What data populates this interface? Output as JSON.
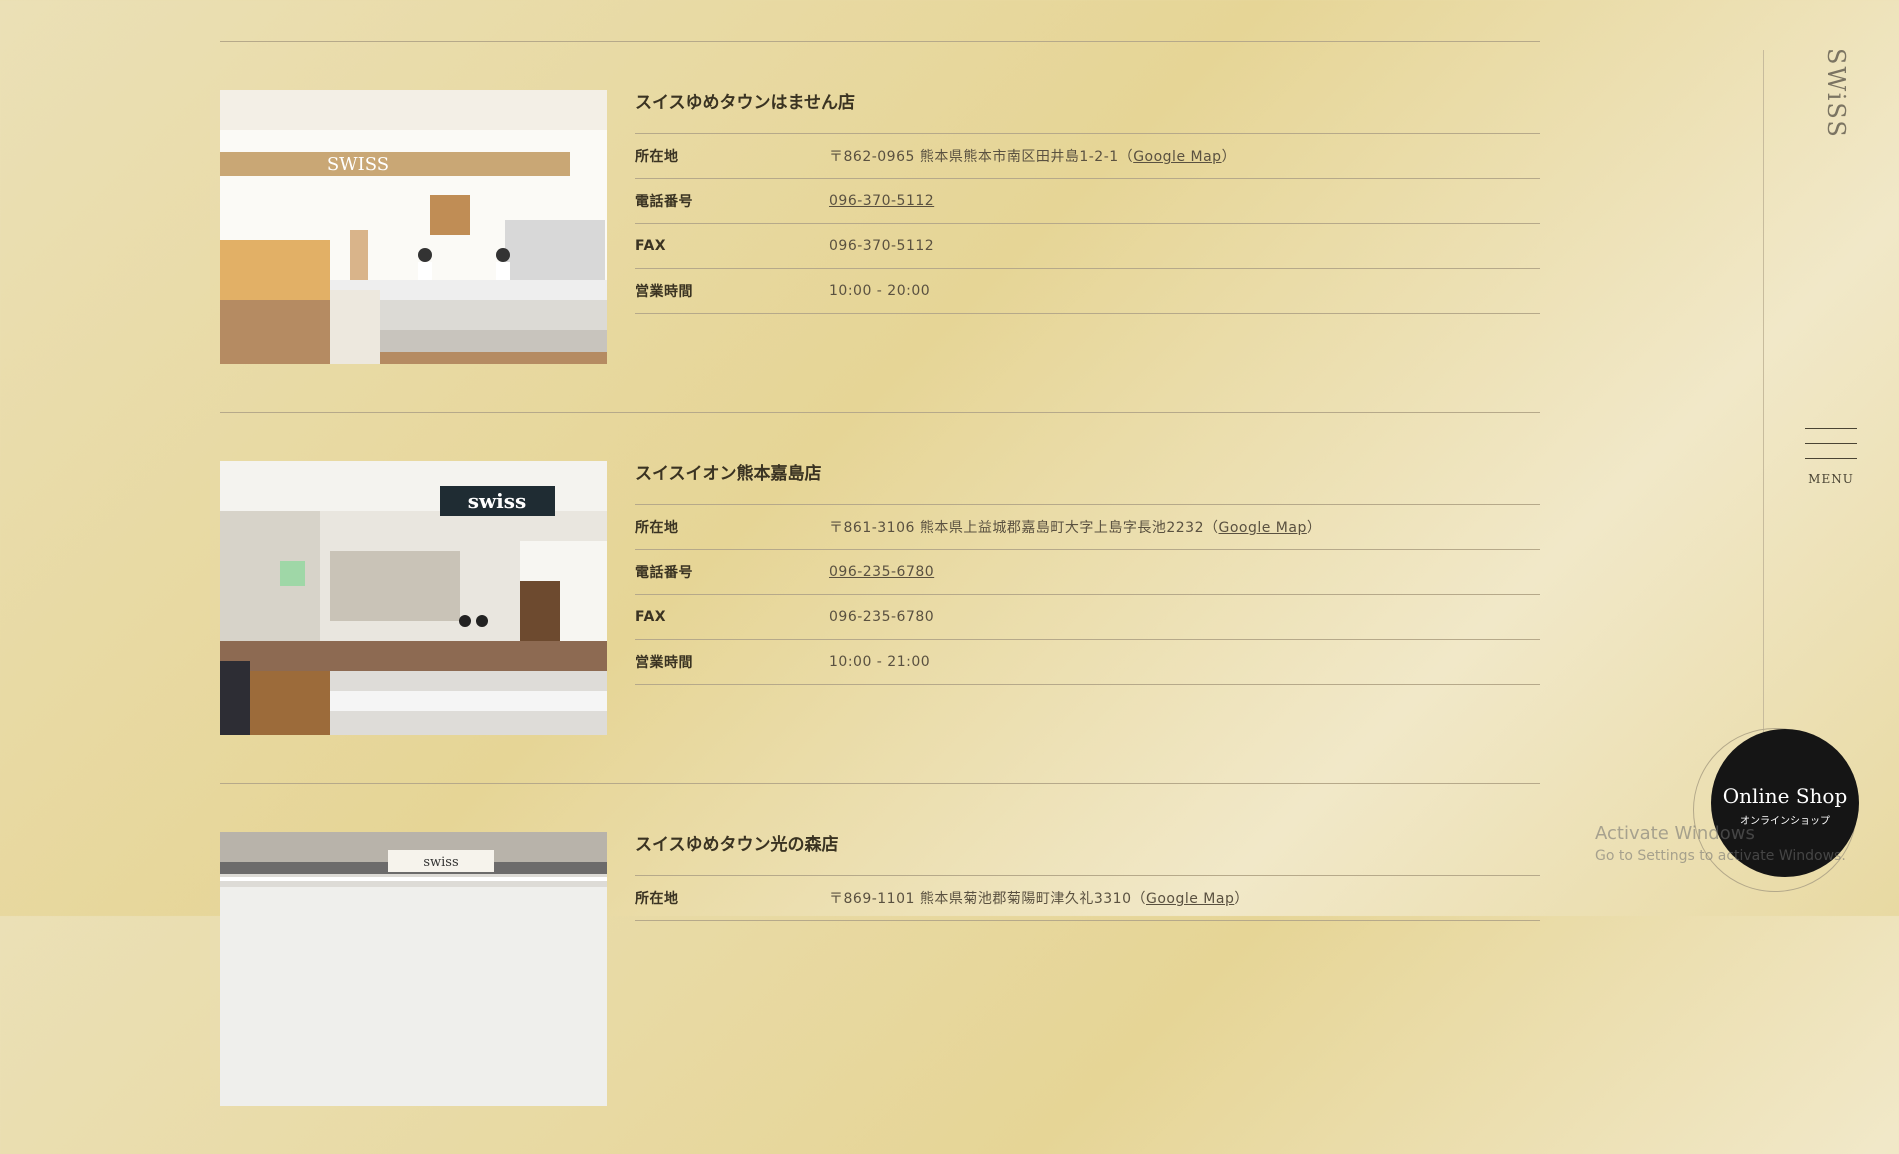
{
  "logo": "SWiSS",
  "menu": {
    "label": "MENU"
  },
  "online_shop": {
    "title": "Online Shop",
    "subtitle": "オンラインショップ"
  },
  "watermark": {
    "title": "Activate Windows",
    "subtitle": "Go to Settings to activate Windows."
  },
  "labels": {
    "address": "所在地",
    "phone": "電話番号",
    "fax": "FAX",
    "hours": "営業時間",
    "map_link": "Google Map"
  },
  "stores": [
    {
      "name": "スイスゆめタウンはません店",
      "photo_sign": "SWISS",
      "address": "〒862-0965 熊本県熊本市南区田井島1-2-1（",
      "phone": "096-370-5112",
      "fax": "096-370-5112",
      "hours": "10:00 - 20:00"
    },
    {
      "name": "スイスイオン熊本嘉島店",
      "photo_sign": "swiss",
      "address": "〒861-3106 熊本県上益城郡嘉島町大字上島字長池2232（",
      "phone": "096-235-6780",
      "fax": "096-235-6780",
      "hours": "10:00 - 21:00"
    },
    {
      "name": "スイスゆめタウン光の森店",
      "photo_sign": "swiss",
      "address": "〒869-1101 熊本県菊池郡菊陽町津久礼3310（"
    }
  ]
}
